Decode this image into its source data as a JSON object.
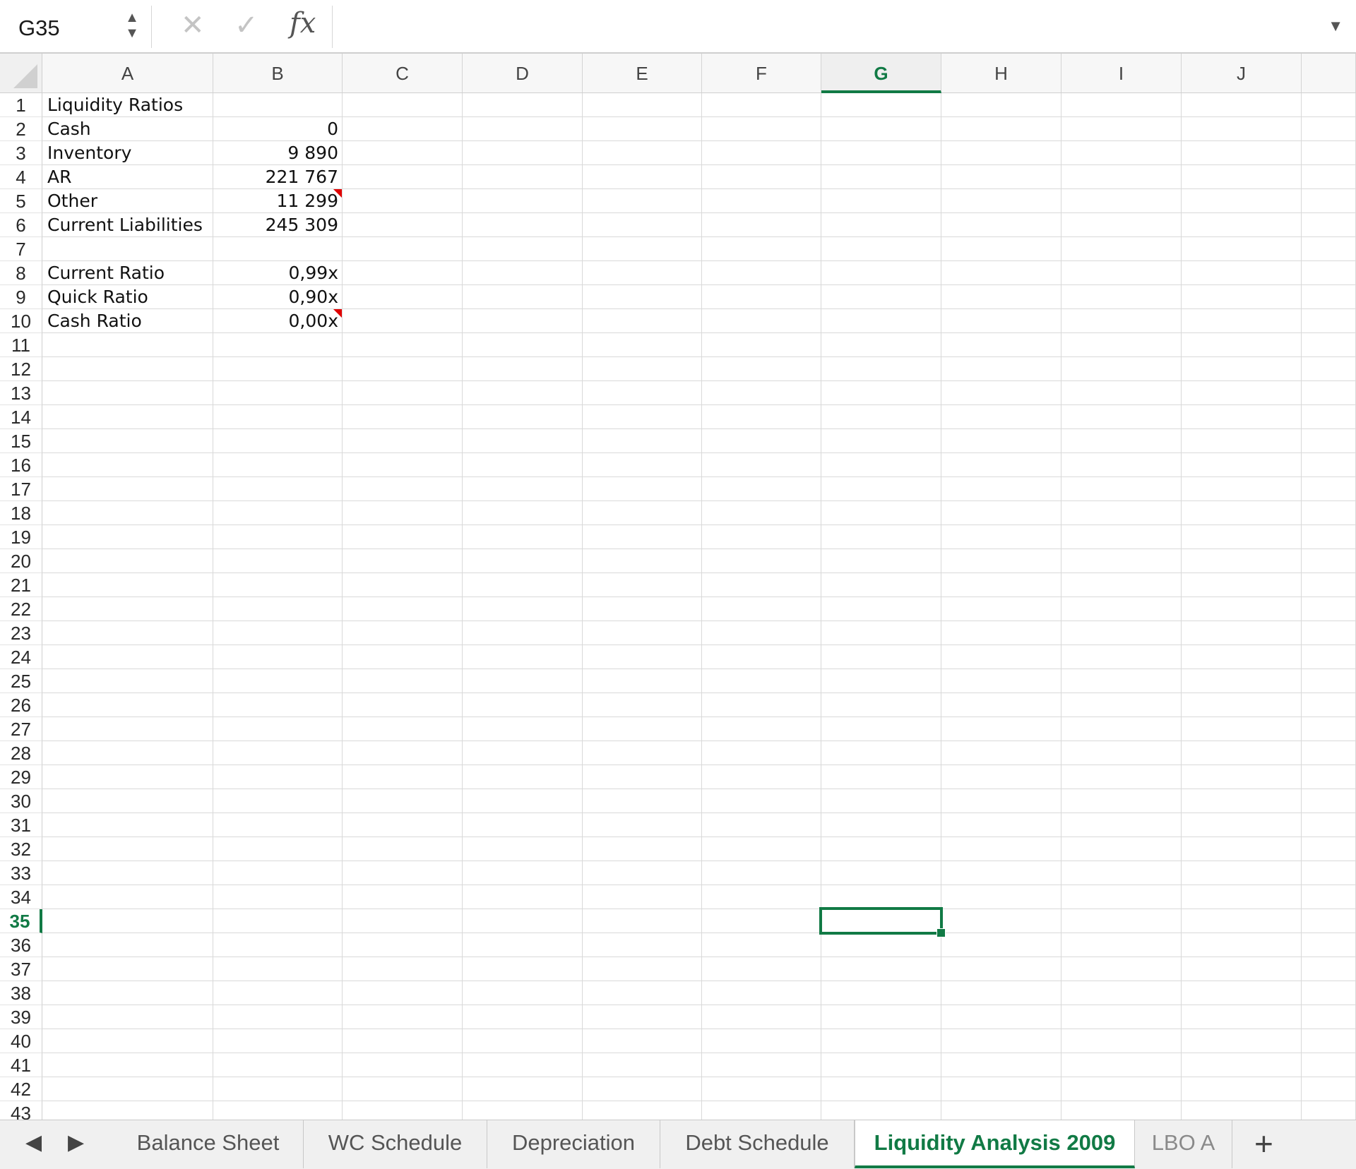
{
  "formula_bar": {
    "name_box": "G35",
    "cancel_icon": "✕",
    "enter_icon": "✓",
    "fx_label": "fx",
    "formula": ""
  },
  "columns": [
    "A",
    "B",
    "C",
    "D",
    "E",
    "F",
    "G",
    "H",
    "I",
    "J"
  ],
  "selected_column": "G",
  "selected_row": "35",
  "rows": [
    "1",
    "2",
    "3",
    "4",
    "5",
    "6",
    "7",
    "8",
    "9",
    "10",
    "11",
    "12",
    "13",
    "14",
    "15",
    "16",
    "17",
    "18",
    "19",
    "20",
    "21",
    "22",
    "23",
    "24",
    "25",
    "26",
    "27",
    "28",
    "29",
    "30",
    "31",
    "32",
    "33",
    "34",
    "35",
    "36",
    "37",
    "38",
    "39",
    "40",
    "41",
    "42",
    "43"
  ],
  "cells": {
    "A1": "Liquidity Ratios",
    "A2": "Cash",
    "B2": "0",
    "A3": "Inventory",
    "B3": "9 890",
    "A4": "AR",
    "B4": "221 767",
    "A5": "Other",
    "B5": "11 299",
    "A6": "Current Liabilities",
    "B6": "245 309",
    "A8": "Current Ratio",
    "B8": "0,99x",
    "A9": "Quick Ratio",
    "B9": "0,90x",
    "A10": "Cash Ratio",
    "B10": "0,00x"
  },
  "sheet_tabs": {
    "prev_icon": "◀",
    "next_icon": "▶",
    "items": [
      "Balance Sheet",
      "WC Schedule",
      "Depreciation",
      "Debt Schedule",
      "Liquidity Analysis 2009",
      "LBO A"
    ],
    "active": "Liquidity Analysis 2009",
    "add_icon": "+"
  },
  "colors": {
    "accent": "#117a45",
    "comment_marker": "#e00000"
  }
}
